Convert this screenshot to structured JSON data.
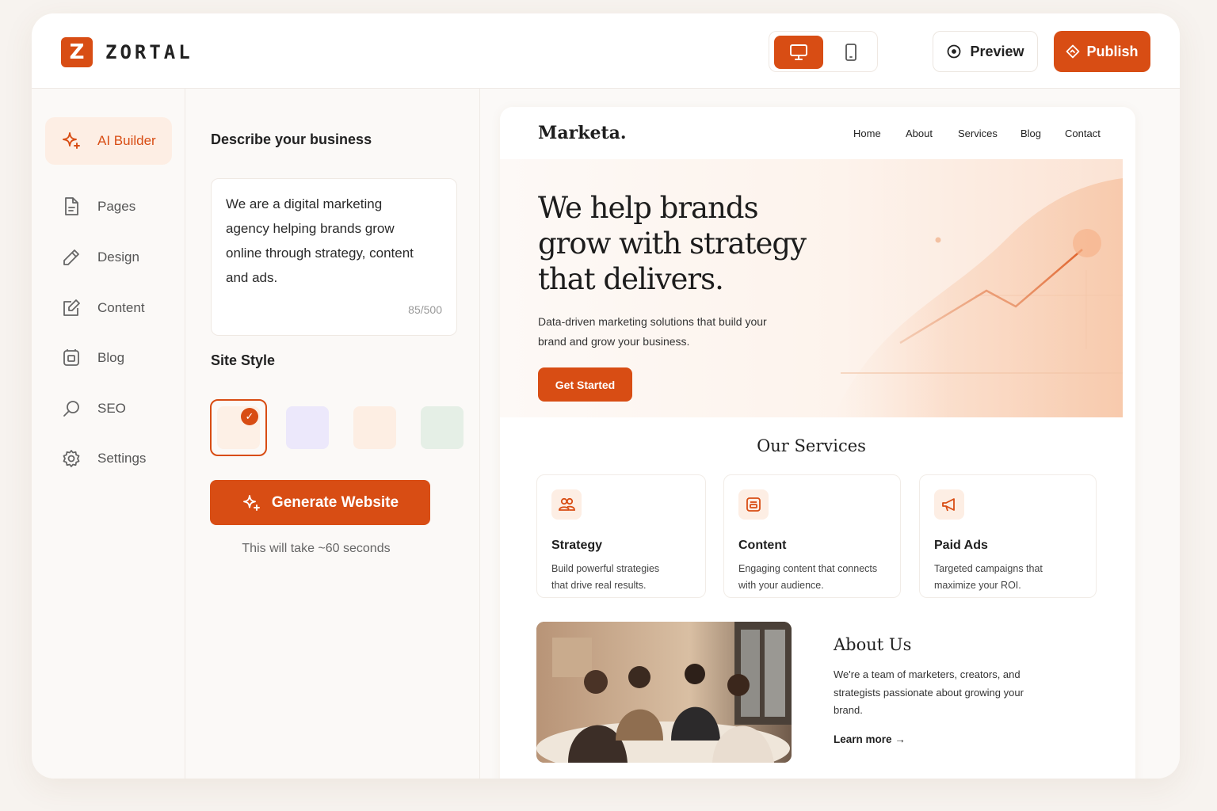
{
  "app": {
    "logo_letter": "Z",
    "logo_text": "ZORTAL",
    "accent_color": "#d84d14"
  },
  "topbar": {
    "device_desktop_icon": "desktop-icon",
    "device_mobile_icon": "mobile-icon",
    "preview_label": "Preview",
    "publish_label": "Publish"
  },
  "sidebar": {
    "items": [
      {
        "label": "AI Builder",
        "icon": "sparkle-icon",
        "active": true
      },
      {
        "label": "Pages",
        "icon": "page-icon"
      },
      {
        "label": "Design",
        "icon": "pencil-icon"
      },
      {
        "label": "Content",
        "icon": "edit-icon"
      },
      {
        "label": "Blog",
        "icon": "blog-icon"
      },
      {
        "label": "SEO",
        "icon": "search-icon"
      },
      {
        "label": "Settings",
        "icon": "gear-icon"
      }
    ]
  },
  "builder": {
    "describe_label": "Describe your business",
    "description": "We are a digital marketing agency helping brands grow online through strategy, content and ads.",
    "char_count": "85/500",
    "style_label": "Site Style",
    "swatches": [
      {
        "color": "#fdf0e6",
        "selected": true
      },
      {
        "color": "#ece8fb"
      },
      {
        "color": "#fdeee3"
      },
      {
        "color": "#e5efe6"
      }
    ],
    "generate_label": "Generate Website",
    "note": "This will take ~60 seconds"
  },
  "site": {
    "brand": "Marketa.",
    "nav": [
      "Home",
      "About",
      "Services",
      "Blog",
      "Contact"
    ],
    "hero_title": "We help brands grow with strategy that delivers.",
    "hero_sub": "Data-driven marketing solutions that build your brand and grow your business.",
    "hero_cta": "Get Started",
    "services_title": "Our Services",
    "services": [
      {
        "name": "Strategy",
        "desc": "Build powerful strategies that drive real results.",
        "icon": "users-icon"
      },
      {
        "name": "Content",
        "desc": "Engaging content that connects with your audience.",
        "icon": "content-icon"
      },
      {
        "name": "Paid Ads",
        "desc": "Targeted campaigns that maximize your ROI.",
        "icon": "megaphone-icon"
      }
    ],
    "about_title": "About Us",
    "about_text": "We're a team of marketers, creators, and strategists passionate about growing your brand.",
    "learn_more": "Learn more →"
  }
}
